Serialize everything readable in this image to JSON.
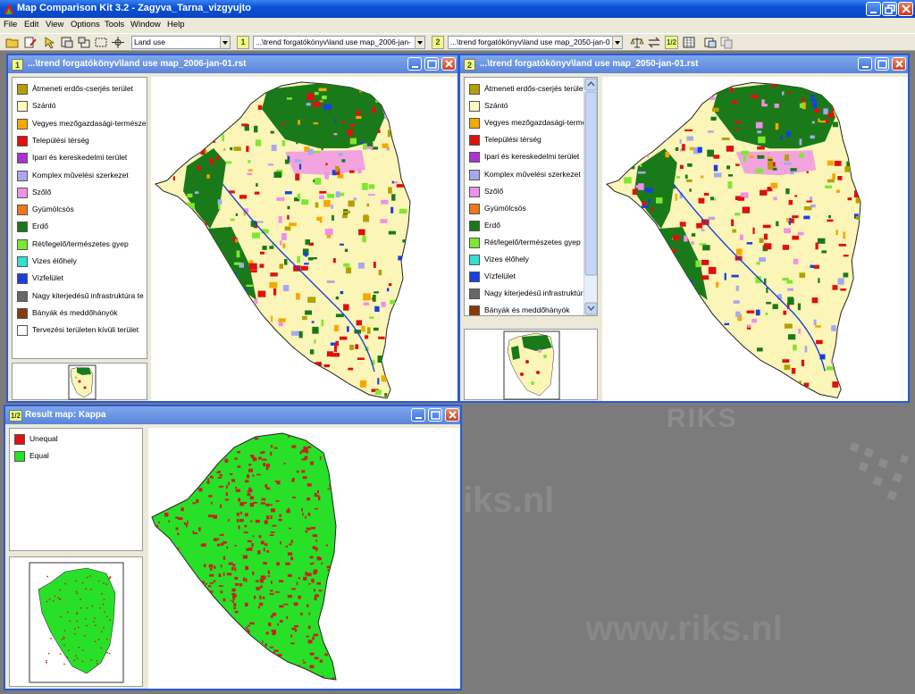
{
  "app": {
    "title": "Map Comparison Kit 3.2 - Zagyva_Tarna_vizgyujto",
    "menu": [
      "File",
      "Edit",
      "View",
      "Options",
      "Tools",
      "Window",
      "Help"
    ]
  },
  "toolbar": {
    "map_type": "Land use",
    "map1_badge": "1",
    "map1_path": "...\\trend forgatókönyv\\land use map_2006-jan-",
    "map2_badge": "2",
    "map2_path": "...\\trend forgatókönyv\\land use map_2050-jan-0",
    "compare_badge": "1/2"
  },
  "window1": {
    "badge": "1",
    "title": "...\\trend forgatókönyv\\land use map_2006-jan-01.rst"
  },
  "window2": {
    "badge": "2",
    "title": "...\\trend forgatókönyv\\land use map_2050-jan-01.rst"
  },
  "legend_landuse": [
    {
      "label": "Átmeneti erdős-cserjés terület",
      "color": "#b5a000"
    },
    {
      "label": "Szántó",
      "color": "#fffac0"
    },
    {
      "label": "Vegyes mezőgazdasági-természe",
      "color": "#f5a800"
    },
    {
      "label": "Települési térség",
      "color": "#e01010"
    },
    {
      "label": "Ipari és kereskedelmi terület",
      "color": "#b030d8"
    },
    {
      "label": "Komplex művelési szerkezet",
      "color": "#a8a8f0"
    },
    {
      "label": "Szőlő",
      "color": "#f090e8"
    },
    {
      "label": "Gyümölcsös",
      "color": "#f07818"
    },
    {
      "label": "Erdő",
      "color": "#1a7a1a"
    },
    {
      "label": "Rét/legelő/természetes gyep",
      "color": "#7ce830"
    },
    {
      "label": "Vizes élőhely",
      "color": "#30e0d0"
    },
    {
      "label": "Vízfelület",
      "color": "#1840e0"
    },
    {
      "label": "Nagy kiterjedésű infrastruktúra te",
      "color": "#686868"
    },
    {
      "label": "Bányák és meddőhányók",
      "color": "#8a3a08"
    },
    {
      "label": "Tervezési területen kívüli terület",
      "color": "#ffffff"
    }
  ],
  "legend_landuse_win2": [
    {
      "label": "Átmeneti erdős-cserjés terület",
      "color": "#b5a000"
    },
    {
      "label": "Szántó",
      "color": "#fffac0"
    },
    {
      "label": "Vegyes mezőgazdasági-termé",
      "color": "#f5a800"
    },
    {
      "label": "Települési térség",
      "color": "#e01010"
    },
    {
      "label": "Ipari és kereskedelmi terület",
      "color": "#b030d8"
    },
    {
      "label": "Komplex művelési szerkezet",
      "color": "#a8a8f0"
    },
    {
      "label": "Szőlő",
      "color": "#f090e8"
    },
    {
      "label": "Gyümölcsös",
      "color": "#f07818"
    },
    {
      "label": "Erdő",
      "color": "#1a7a1a"
    },
    {
      "label": "Rét/legelő/természetes gyep",
      "color": "#7ce830"
    },
    {
      "label": "Vizes élőhely",
      "color": "#30e0d0"
    },
    {
      "label": "Vízfelület",
      "color": "#1840e0"
    },
    {
      "label": "Nagy kiterjedésű infrastruktúra",
      "color": "#686868"
    },
    {
      "label": "Bányák és meddőhányók",
      "color": "#8a3a08"
    }
  ],
  "result": {
    "badge": "1/2",
    "title": "Result map: Kappa",
    "legend": [
      {
        "label": "Unequal",
        "color": "#e01010"
      },
      {
        "label": "Equal",
        "color": "#28e028"
      }
    ]
  },
  "watermark": {
    "brand": "RIKS",
    "url_partial": "iks.nl",
    "url": "www.riks.nl"
  },
  "colors": {
    "desktop": "#7b7b7b",
    "window_border": "#2a5ad8",
    "map_base": "#fbf5b8",
    "forest": "#1a7a1a",
    "urban": "#e01010",
    "equal": "#28e028",
    "unequal": "#c82020"
  }
}
